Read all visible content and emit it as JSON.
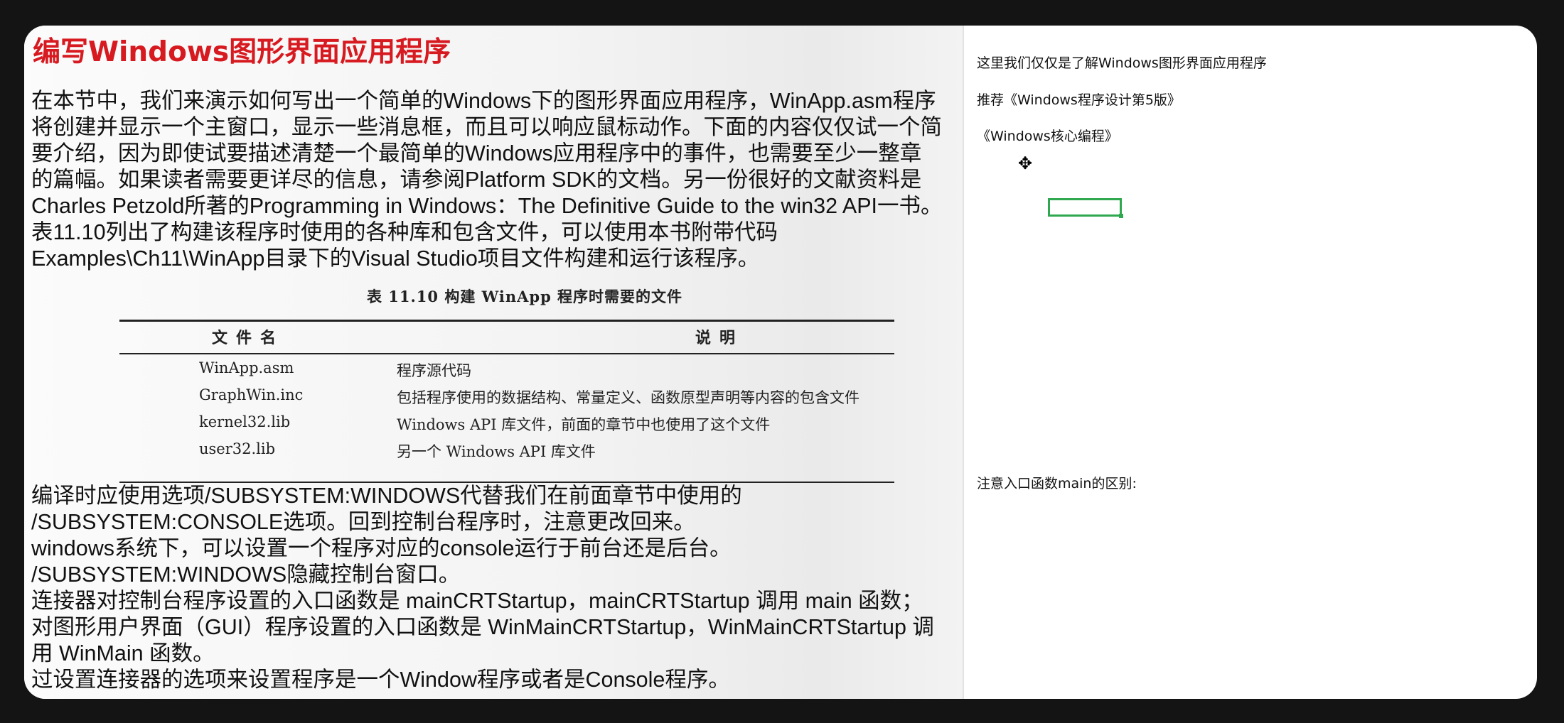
{
  "slide": {
    "title": "编写Windows图形界面应用程序",
    "intro_lines": [
      "在本节中，我们来演示如何写出一个简单的Windows下的图形界面应用程序，WinApp.asm程序",
      "将创建并显示一个主窗口，显示一些消息框，而且可以响应鼠标动作。下面的内容仅仅试一个简",
      "要介绍，因为即使试要描述清楚一个最简单的Windows应用程序中的事件，也需要至少一整章",
      "的篇幅。如果读者需要更详尽的信息，请参阅Platform SDK的文档。另一份很好的文献资料是",
      "Charles Petzold所著的Programming in Windows：The Definitive Guide to the win32 API一书。",
      "表11.10列出了构建该程序时使用的各种库和包含文件，可以使用本书附带代码",
      "Examples\\Ch11\\WinApp目录下的Visual Studio项目文件构建和运行该程序。"
    ],
    "table": {
      "caption": "表 11.10   构建 WinApp 程序时需要的文件",
      "headers": [
        "文件名",
        "说明"
      ],
      "rows": [
        {
          "file": "WinApp.asm",
          "desc": "程序源代码"
        },
        {
          "file": "GraphWin.inc",
          "desc": "包括程序使用的数据结构、常量定义、函数原型声明等内容的包含文件"
        },
        {
          "file": "kernel32.lib",
          "desc": "Windows API 库文件，前面的章节中也使用了这个文件"
        },
        {
          "file": "user32.lib",
          "desc": "另一个 Windows API 库文件"
        }
      ]
    },
    "body_lines": [
      "编译时应使用选项/SUBSYSTEM:WINDOWS代替我们在前面章节中使用的",
      "/SUBSYSTEM:CONSOLE选项。回到控制台程序时，注意更改回来。",
      "windows系统下，可以设置一个程序对应的console运行于前台还是后台。",
      "/SUBSYSTEM:WINDOWS隐藏控制台窗口。",
      "连接器对控制台程序设置的入口函数是 mainCRTStartup，mainCRTStartup 调用 main 函数；",
      "对图形用户界面（GUI）程序设置的入口函数是 WinMainCRTStartup，WinMainCRTStartup 调",
      "用 WinMain 函数。",
      "过设置连接器的选项来设置程序是一个Window程序或者是Console程序。"
    ]
  },
  "notes": {
    "line1": "这里我们仅仅是了解Windows图形界面应用程序",
    "line2": "推荐《Windows程序设计第5版》",
    "line3": "《Windows核心编程》",
    "line4": "注意入口函数main的区别:"
  },
  "icons": {
    "cursor": "move-cursor-icon",
    "cursor_glyph": "✥",
    "selection_color": "#2fa84f"
  },
  "colors": {
    "title": "#d71920",
    "background": "#141414"
  }
}
